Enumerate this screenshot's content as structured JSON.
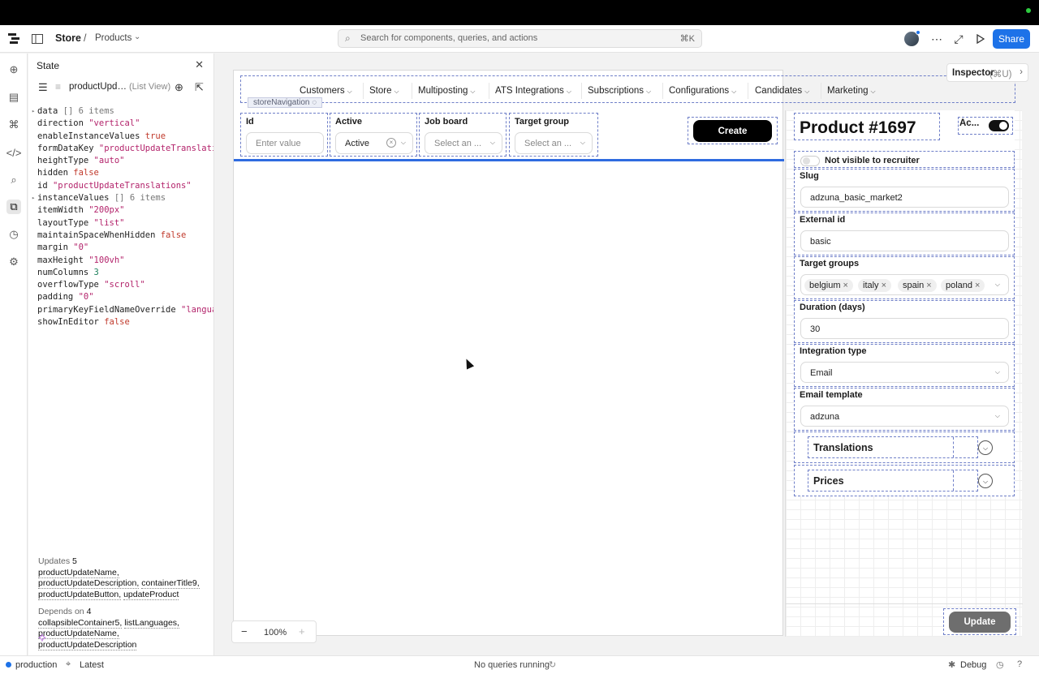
{
  "header": {
    "app": "Store",
    "separator": "/",
    "page": "Products",
    "search_placeholder": "Search for components, queries, and actions",
    "search_shortcut": "⌘K",
    "share_label": "Share"
  },
  "state_panel": {
    "title": "State",
    "component": "productUpd…",
    "component_type": "(List View)",
    "props": [
      {
        "key": "data",
        "value": "[]",
        "meta": "6 items",
        "kind": "meta",
        "expandable": true
      },
      {
        "key": "direction",
        "value": "\"vertical\"",
        "kind": "str"
      },
      {
        "key": "enableInstanceValues",
        "value": "true",
        "kind": "bool"
      },
      {
        "key": "formDataKey",
        "value": "\"productUpdateTranslation…",
        "kind": "str"
      },
      {
        "key": "heightType",
        "value": "\"auto\"",
        "kind": "str"
      },
      {
        "key": "hidden",
        "value": "false",
        "kind": "bool"
      },
      {
        "key": "id",
        "value": "\"productUpdateTranslations\"",
        "kind": "str"
      },
      {
        "key": "instanceValues",
        "value": "[]",
        "meta": "6 items",
        "kind": "meta",
        "expandable": true
      },
      {
        "key": "itemWidth",
        "value": "\"200px\"",
        "kind": "str"
      },
      {
        "key": "layoutType",
        "value": "\"list\"",
        "kind": "str"
      },
      {
        "key": "maintainSpaceWhenHidden",
        "value": "false",
        "kind": "bool"
      },
      {
        "key": "margin",
        "value": "\"0\"",
        "kind": "str"
      },
      {
        "key": "maxHeight",
        "value": "\"100vh\"",
        "kind": "str"
      },
      {
        "key": "numColumns",
        "value": "3",
        "kind": "num"
      },
      {
        "key": "overflowType",
        "value": "\"scroll\"",
        "kind": "str"
      },
      {
        "key": "padding",
        "value": "\"0\"",
        "kind": "str"
      },
      {
        "key": "primaryKeyFieldNameOverride",
        "value": "\"language\"",
        "kind": "str"
      },
      {
        "key": "showInEditor",
        "value": "false",
        "kind": "bool"
      }
    ],
    "updates_label": "Updates",
    "updates_count": "5",
    "updates": [
      "productUpdateName,",
      "productUpdateDescription,",
      "containerTitle9,",
      "productUpdateButton,",
      "updateProduct"
    ],
    "depends_label": "Depends on",
    "depends_count": "4",
    "depends": [
      "collapsibleContainer5,",
      "listLanguages,",
      "productUpdateName,",
      "productUpdateDescription"
    ]
  },
  "canvas": {
    "nav_items": [
      "Customers",
      "Store",
      "Multiposting",
      "ATS Integrations",
      "Subscriptions",
      "Configurations",
      "Candidates",
      "Marketing"
    ],
    "nav_tag": "storeNavigation",
    "filters": {
      "id_label": "Id",
      "id_placeholder": "Enter value",
      "active_label": "Active",
      "active_value": "Active",
      "jobboard_label": "Job board",
      "jobboard_placeholder": "Select an ...",
      "target_label": "Target group",
      "target_placeholder": "Select an ..."
    },
    "create_label": "Create",
    "zoom": "100%",
    "inspector_label": "Inspector",
    "inspector_shortcut": "(⌘U)"
  },
  "product": {
    "title": "Product #1697",
    "active_short": "Ac...",
    "visibility_label": "Not visible to recruiter",
    "slug_label": "Slug",
    "slug_value": "adzuna_basic_market2",
    "external_label": "External id",
    "external_value": "basic",
    "targets_label": "Target groups",
    "targets": [
      "belgium",
      "italy",
      "spain",
      "poland"
    ],
    "duration_label": "Duration (days)",
    "duration_value": "30",
    "integration_label": "Integration type",
    "integration_value": "Email",
    "template_label": "Email template",
    "template_value": "adzuna",
    "translations_label": "Translations",
    "prices_label": "Prices",
    "update_label": "Update"
  },
  "footer": {
    "environment": "production",
    "release": "Latest",
    "queries_status": "No queries running",
    "debug_label": "Debug"
  },
  "colors": {
    "accent": "#1d72e8",
    "selection_outline": "#6f7fc8",
    "table_bottom_border": "#2f6be0"
  }
}
